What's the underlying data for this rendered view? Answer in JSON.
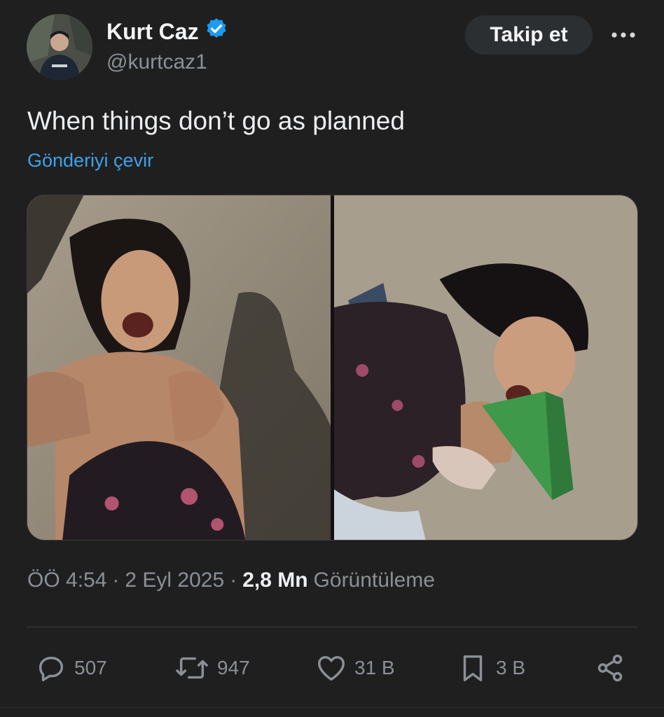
{
  "author": {
    "name": "Kurt Caz",
    "handle": "@kurtcaz1",
    "verified": true
  },
  "follow_label": "Takip et",
  "more_icon": "ellipsis-icon",
  "post_text": "When things don’t go as planned",
  "translate_label": "Gönderiyi çevir",
  "media": {
    "count": 2,
    "panels": [
      "photo-left",
      "photo-right"
    ]
  },
  "meta": {
    "time": "ÖÖ 4:54",
    "dot": "·",
    "date": "2 Eyl 2025",
    "views_value": "2,8 Mn",
    "views_label": "Görüntüleme"
  },
  "actions": {
    "replies": "507",
    "reposts": "947",
    "likes": "31 B",
    "bookmarks": "3 B"
  },
  "colors": {
    "background": "#1f1f20",
    "accent": "#3fa1e8",
    "verified": "#1d9bf0",
    "muted": "#8b9096"
  }
}
